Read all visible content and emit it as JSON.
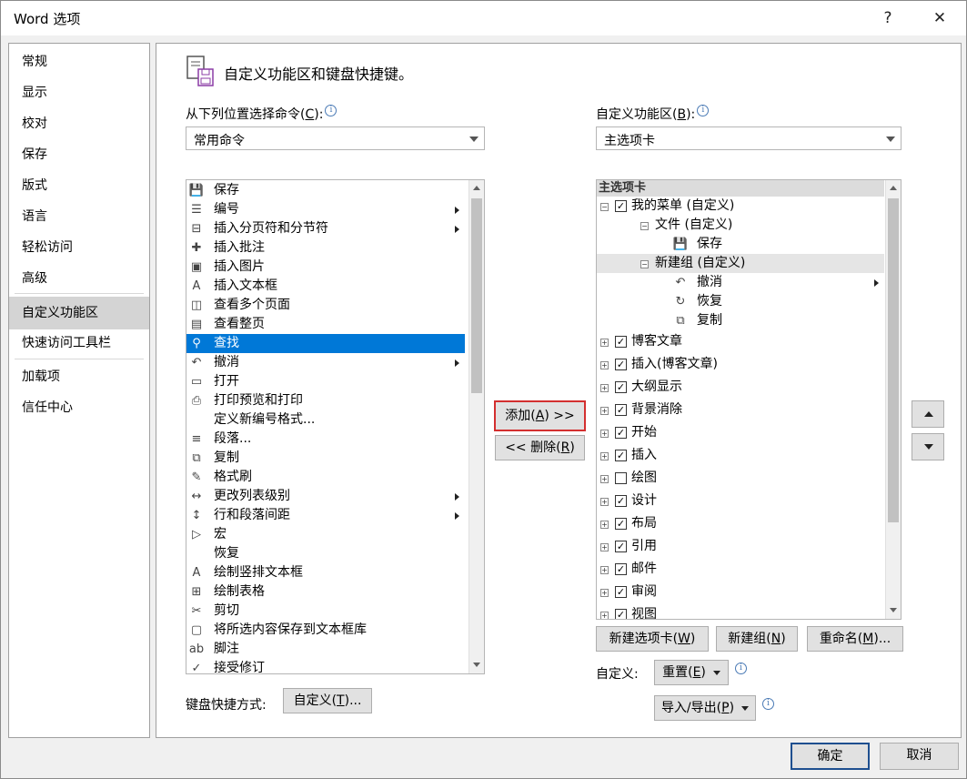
{
  "window": {
    "title": "Word 选项",
    "help": "?",
    "close": "✕"
  },
  "nav": {
    "items": [
      {
        "label": "常规"
      },
      {
        "label": "显示"
      },
      {
        "label": "校对"
      },
      {
        "label": "保存"
      },
      {
        "label": "版式"
      },
      {
        "label": "语言"
      },
      {
        "label": "轻松访问"
      },
      {
        "label": "高级"
      },
      {
        "label": "自定义功能区",
        "active": true
      },
      {
        "label": "快速访问工具栏"
      },
      {
        "label": "加载项"
      },
      {
        "label": "信任中心"
      }
    ]
  },
  "header": {
    "title": "自定义功能区和键盘快捷键。"
  },
  "left": {
    "label_pre": "从下列位置选择命令(",
    "label_key": "C",
    "label_post": "):",
    "combo_value": "常用命令",
    "commands": [
      {
        "icon": "save-icon",
        "glyph": "💾",
        "label": "保存"
      },
      {
        "icon": "numbering-icon",
        "glyph": "☰",
        "label": "编号",
        "submenu": true
      },
      {
        "icon": "page-break-icon",
        "glyph": "⊟",
        "label": "插入分页符和分节符",
        "submenu": true
      },
      {
        "icon": "comment-icon",
        "glyph": "✚",
        "label": "插入批注"
      },
      {
        "icon": "picture-icon",
        "glyph": "▣",
        "label": "插入图片"
      },
      {
        "icon": "textbox-icon",
        "glyph": "A",
        "label": "插入文本框"
      },
      {
        "icon": "multipage-icon",
        "glyph": "◫",
        "label": "查看多个页面"
      },
      {
        "icon": "onepage-icon",
        "glyph": "▤",
        "label": "查看整页"
      },
      {
        "icon": "search-icon",
        "glyph": "⚲",
        "label": "查找",
        "selected": true
      },
      {
        "icon": "undo-icon",
        "glyph": "↶",
        "label": "撤消",
        "submenu": true
      },
      {
        "icon": "open-icon",
        "glyph": "▭",
        "label": "打开"
      },
      {
        "icon": "print-preview-icon",
        "glyph": "⎙",
        "label": "打印预览和打印"
      },
      {
        "icon": "none",
        "glyph": "",
        "label": "定义新编号格式..."
      },
      {
        "icon": "paragraph-icon",
        "glyph": "≡",
        "label": "段落..."
      },
      {
        "icon": "copy-icon",
        "glyph": "⧉",
        "label": "复制"
      },
      {
        "icon": "format-painter-icon",
        "glyph": "✎",
        "label": "格式刷"
      },
      {
        "icon": "list-level-icon",
        "glyph": "↔",
        "label": "更改列表级别",
        "submenu": true
      },
      {
        "icon": "line-spacing-icon",
        "glyph": "↕",
        "label": "行和段落间距",
        "submenu": true
      },
      {
        "icon": "macro-icon",
        "glyph": "▷",
        "label": "宏"
      },
      {
        "icon": "none",
        "glyph": "",
        "label": "恢复"
      },
      {
        "icon": "vertical-textbox-icon",
        "glyph": "A",
        "label": "绘制竖排文本框"
      },
      {
        "icon": "draw-table-icon",
        "glyph": "⊞",
        "label": "绘制表格"
      },
      {
        "icon": "cut-icon",
        "glyph": "✂",
        "label": "剪切"
      },
      {
        "icon": "save-selection-icon",
        "glyph": "▢",
        "label": "将所选内容保存到文本框库"
      },
      {
        "icon": "footnote-icon",
        "glyph": "ab",
        "label": "脚注"
      },
      {
        "icon": "accept-change-icon",
        "glyph": "✓",
        "label": "接受修订"
      }
    ],
    "shortcut_label": "键盘快捷方式:",
    "customize_btn_pre": "自定义(",
    "customize_btn_key": "T",
    "customize_btn_post": ")..."
  },
  "middle": {
    "add_pre": "添加(",
    "add_key": "A",
    "add_post": ") >>",
    "remove_pre": "<< 删除(",
    "remove_key": "R",
    "remove_post": ")"
  },
  "right": {
    "label_pre": "自定义功能区(",
    "label_key": "B",
    "label_post": "):",
    "combo_value": "主选项卡",
    "tree_header": "主选项卡",
    "tree": [
      {
        "level": 0,
        "pm": "⊟",
        "checked": true,
        "label": "我的菜单 (自定义)"
      },
      {
        "level": 1,
        "pm": "⊟",
        "label": "文件 (自定义)"
      },
      {
        "level": 2,
        "icon": "save-icon",
        "glyph": "💾",
        "label": "保存"
      },
      {
        "level": 1,
        "pm": "⊟",
        "label": "新建组 (自定义)",
        "highlight": true
      },
      {
        "level": 2,
        "icon": "undo-icon",
        "glyph": "↶",
        "label": "撤消",
        "submenu": true
      },
      {
        "level": 2,
        "icon": "redo-icon",
        "glyph": "↻",
        "label": "恢复"
      },
      {
        "level": 2,
        "icon": "copy-icon",
        "glyph": "⧉",
        "label": "复制"
      },
      {
        "level": 0,
        "pm": "⊞",
        "checked": true,
        "label": "博客文章"
      },
      {
        "level": 0,
        "pm": "⊞",
        "checked": true,
        "label": "插入(博客文章)"
      },
      {
        "level": 0,
        "pm": "⊞",
        "checked": true,
        "label": "大纲显示"
      },
      {
        "level": 0,
        "pm": "⊞",
        "checked": true,
        "label": "背景消除"
      },
      {
        "level": 0,
        "pm": "⊞",
        "checked": true,
        "label": "开始"
      },
      {
        "level": 0,
        "pm": "⊞",
        "checked": true,
        "label": "插入"
      },
      {
        "level": 0,
        "pm": "⊞",
        "checked": false,
        "label": "绘图"
      },
      {
        "level": 0,
        "pm": "⊞",
        "checked": true,
        "label": "设计"
      },
      {
        "level": 0,
        "pm": "⊞",
        "checked": true,
        "label": "布局"
      },
      {
        "level": 0,
        "pm": "⊞",
        "checked": true,
        "label": "引用"
      },
      {
        "level": 0,
        "pm": "⊞",
        "checked": true,
        "label": "邮件"
      },
      {
        "level": 0,
        "pm": "⊞",
        "checked": true,
        "label": "审阅"
      },
      {
        "level": 0,
        "pm": "⊞",
        "checked": true,
        "label": "视图"
      }
    ],
    "new_tab_pre": "新建选项卡(",
    "new_tab_key": "W",
    "new_tab_post": ")",
    "new_group_pre": "新建组(",
    "new_group_key": "N",
    "new_group_post": ")",
    "rename_pre": "重命名(",
    "rename_key": "M",
    "rename_post": ")...",
    "customize_label": "自定义:",
    "reset_pre": "重置(",
    "reset_key": "E",
    "reset_post": ")",
    "import_pre": "导入/导出(",
    "import_key": "P",
    "import_post": ")"
  },
  "footer": {
    "ok": "确定",
    "cancel": "取消"
  }
}
